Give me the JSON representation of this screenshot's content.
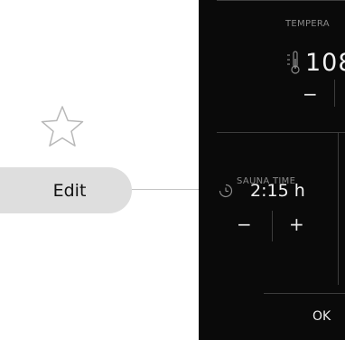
{
  "favorite": {
    "icon": "star-outline-icon"
  },
  "edit": {
    "label": "Edit"
  },
  "panel": {
    "temperature": {
      "label": "TEMPERA",
      "value": "108",
      "icon": "thermometer-icon",
      "minus": "−"
    },
    "sauna_time": {
      "label": "SAUNA TIME",
      "value": "2:15 h",
      "icon": "clock-icon",
      "minus": "−",
      "plus": "+"
    },
    "ok_label": "OK"
  },
  "colors": {
    "panel_bg": "#0a0a0a",
    "edit_bg": "#dedede",
    "divider": "#3c3c3c",
    "label_text": "#8a8a8a"
  }
}
